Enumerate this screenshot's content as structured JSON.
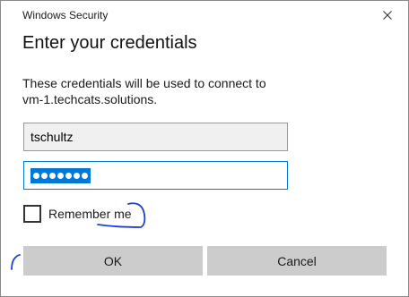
{
  "window": {
    "app_title": "Windows Security",
    "close_icon": "close-icon"
  },
  "dialog": {
    "heading": "Enter your credentials",
    "message_line1": "These credentials will be used to connect to",
    "message_line2": "vm-1.techcats.solutions."
  },
  "form": {
    "username_value": "tschultz",
    "password_masked_length": 7,
    "password_selected": true,
    "remember_label": "Remember me",
    "remember_checked": false
  },
  "buttons": {
    "ok_label": "OK",
    "cancel_label": "Cancel"
  },
  "colors": {
    "accent": "#0078d4",
    "selection": "#0078d7",
    "button_bg": "#cccccc",
    "annotation_ink": "#1a3fd6"
  }
}
